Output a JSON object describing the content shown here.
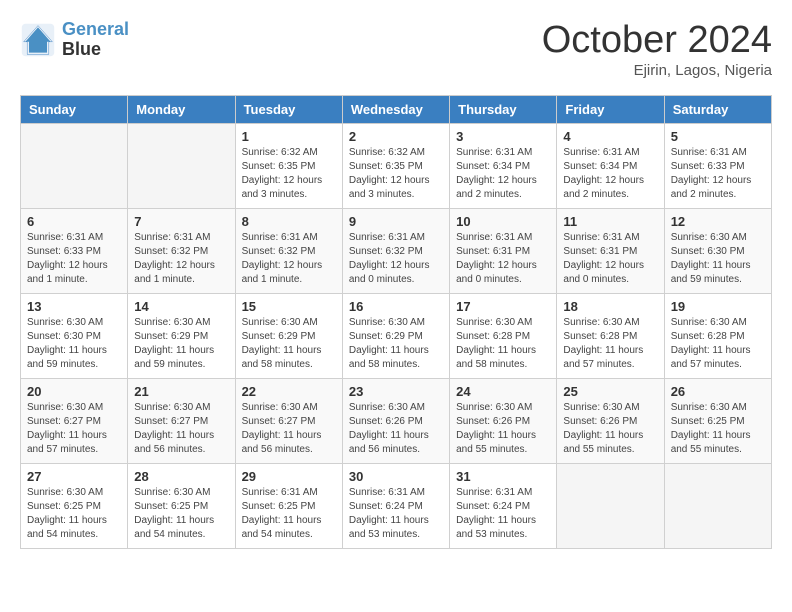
{
  "header": {
    "logo_line1": "General",
    "logo_line2": "Blue",
    "month": "October 2024",
    "location": "Ejirin, Lagos, Nigeria"
  },
  "weekdays": [
    "Sunday",
    "Monday",
    "Tuesday",
    "Wednesday",
    "Thursday",
    "Friday",
    "Saturday"
  ],
  "weeks": [
    [
      {
        "day": "",
        "empty": true
      },
      {
        "day": "",
        "empty": true
      },
      {
        "day": "1",
        "sunrise": "6:32 AM",
        "sunset": "6:35 PM",
        "daylight": "12 hours and 3 minutes."
      },
      {
        "day": "2",
        "sunrise": "6:32 AM",
        "sunset": "6:35 PM",
        "daylight": "12 hours and 3 minutes."
      },
      {
        "day": "3",
        "sunrise": "6:31 AM",
        "sunset": "6:34 PM",
        "daylight": "12 hours and 2 minutes."
      },
      {
        "day": "4",
        "sunrise": "6:31 AM",
        "sunset": "6:34 PM",
        "daylight": "12 hours and 2 minutes."
      },
      {
        "day": "5",
        "sunrise": "6:31 AM",
        "sunset": "6:33 PM",
        "daylight": "12 hours and 2 minutes."
      }
    ],
    [
      {
        "day": "6",
        "sunrise": "6:31 AM",
        "sunset": "6:33 PM",
        "daylight": "12 hours and 1 minute."
      },
      {
        "day": "7",
        "sunrise": "6:31 AM",
        "sunset": "6:32 PM",
        "daylight": "12 hours and 1 minute."
      },
      {
        "day": "8",
        "sunrise": "6:31 AM",
        "sunset": "6:32 PM",
        "daylight": "12 hours and 1 minute."
      },
      {
        "day": "9",
        "sunrise": "6:31 AM",
        "sunset": "6:32 PM",
        "daylight": "12 hours and 0 minutes."
      },
      {
        "day": "10",
        "sunrise": "6:31 AM",
        "sunset": "6:31 PM",
        "daylight": "12 hours and 0 minutes."
      },
      {
        "day": "11",
        "sunrise": "6:31 AM",
        "sunset": "6:31 PM",
        "daylight": "12 hours and 0 minutes."
      },
      {
        "day": "12",
        "sunrise": "6:30 AM",
        "sunset": "6:30 PM",
        "daylight": "11 hours and 59 minutes."
      }
    ],
    [
      {
        "day": "13",
        "sunrise": "6:30 AM",
        "sunset": "6:30 PM",
        "daylight": "11 hours and 59 minutes."
      },
      {
        "day": "14",
        "sunrise": "6:30 AM",
        "sunset": "6:29 PM",
        "daylight": "11 hours and 59 minutes."
      },
      {
        "day": "15",
        "sunrise": "6:30 AM",
        "sunset": "6:29 PM",
        "daylight": "11 hours and 58 minutes."
      },
      {
        "day": "16",
        "sunrise": "6:30 AM",
        "sunset": "6:29 PM",
        "daylight": "11 hours and 58 minutes."
      },
      {
        "day": "17",
        "sunrise": "6:30 AM",
        "sunset": "6:28 PM",
        "daylight": "11 hours and 58 minutes."
      },
      {
        "day": "18",
        "sunrise": "6:30 AM",
        "sunset": "6:28 PM",
        "daylight": "11 hours and 57 minutes."
      },
      {
        "day": "19",
        "sunrise": "6:30 AM",
        "sunset": "6:28 PM",
        "daylight": "11 hours and 57 minutes."
      }
    ],
    [
      {
        "day": "20",
        "sunrise": "6:30 AM",
        "sunset": "6:27 PM",
        "daylight": "11 hours and 57 minutes."
      },
      {
        "day": "21",
        "sunrise": "6:30 AM",
        "sunset": "6:27 PM",
        "daylight": "11 hours and 56 minutes."
      },
      {
        "day": "22",
        "sunrise": "6:30 AM",
        "sunset": "6:27 PM",
        "daylight": "11 hours and 56 minutes."
      },
      {
        "day": "23",
        "sunrise": "6:30 AM",
        "sunset": "6:26 PM",
        "daylight": "11 hours and 56 minutes."
      },
      {
        "day": "24",
        "sunrise": "6:30 AM",
        "sunset": "6:26 PM",
        "daylight": "11 hours and 55 minutes."
      },
      {
        "day": "25",
        "sunrise": "6:30 AM",
        "sunset": "6:26 PM",
        "daylight": "11 hours and 55 minutes."
      },
      {
        "day": "26",
        "sunrise": "6:30 AM",
        "sunset": "6:25 PM",
        "daylight": "11 hours and 55 minutes."
      }
    ],
    [
      {
        "day": "27",
        "sunrise": "6:30 AM",
        "sunset": "6:25 PM",
        "daylight": "11 hours and 54 minutes."
      },
      {
        "day": "28",
        "sunrise": "6:30 AM",
        "sunset": "6:25 PM",
        "daylight": "11 hours and 54 minutes."
      },
      {
        "day": "29",
        "sunrise": "6:31 AM",
        "sunset": "6:25 PM",
        "daylight": "11 hours and 54 minutes."
      },
      {
        "day": "30",
        "sunrise": "6:31 AM",
        "sunset": "6:24 PM",
        "daylight": "11 hours and 53 minutes."
      },
      {
        "day": "31",
        "sunrise": "6:31 AM",
        "sunset": "6:24 PM",
        "daylight": "11 hours and 53 minutes."
      },
      {
        "day": "",
        "empty": true
      },
      {
        "day": "",
        "empty": true
      }
    ]
  ]
}
